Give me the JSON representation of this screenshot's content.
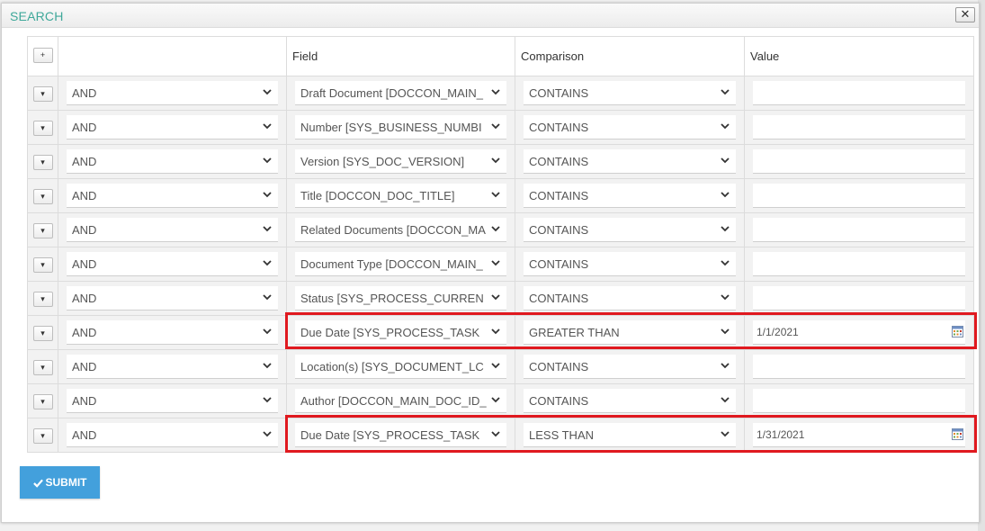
{
  "dialog": {
    "title": "SEARCH",
    "close_label": "✕"
  },
  "grid": {
    "add_label": "+",
    "headers": {
      "logic": "",
      "field": "Field",
      "comparison": "Comparison",
      "value": "Value"
    },
    "rows": [
      {
        "logic": "AND",
        "field": "Draft Document [DOCCON_MAIN_",
        "comparison": "CONTAINS",
        "value": ""
      },
      {
        "logic": "AND",
        "field": "Number [SYS_BUSINESS_NUMBI",
        "comparison": "CONTAINS",
        "value": ""
      },
      {
        "logic": "AND",
        "field": "Version [SYS_DOC_VERSION]",
        "comparison": "CONTAINS",
        "value": ""
      },
      {
        "logic": "AND",
        "field": "Title [DOCCON_DOC_TITLE]",
        "comparison": "CONTAINS",
        "value": ""
      },
      {
        "logic": "AND",
        "field": "Related Documents [DOCCON_MA",
        "comparison": "CONTAINS",
        "value": ""
      },
      {
        "logic": "AND",
        "field": "Document Type [DOCCON_MAIN_",
        "comparison": "CONTAINS",
        "value": ""
      },
      {
        "logic": "AND",
        "field": "Status [SYS_PROCESS_CURREN",
        "comparison": "CONTAINS",
        "value": ""
      },
      {
        "logic": "AND",
        "field": "Due Date [SYS_PROCESS_TASK",
        "comparison": "GREATER THAN",
        "value": "1/1/2021",
        "date": true
      },
      {
        "logic": "AND",
        "field": "Location(s) [SYS_DOCUMENT_LC",
        "comparison": "CONTAINS",
        "value": ""
      },
      {
        "logic": "AND",
        "field": "Author [DOCCON_MAIN_DOC_ID_",
        "comparison": "CONTAINS",
        "value": ""
      },
      {
        "logic": "AND",
        "field": "Due Date [SYS_PROCESS_TASK",
        "comparison": "LESS THAN",
        "value": "1/31/2021",
        "date": true
      }
    ]
  },
  "submit": {
    "label": "SUBMIT"
  },
  "colors": {
    "title": "#3fa89a",
    "highlight": "#e0191f",
    "submit": "#43a0dc"
  }
}
